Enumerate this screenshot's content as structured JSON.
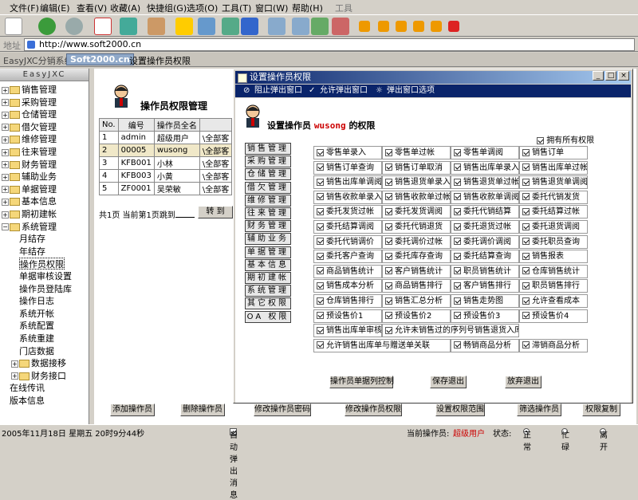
{
  "menu": [
    "文件(F)",
    "编辑(E)",
    "查看(V)",
    "收藏(A)",
    "快捷组(G)",
    "选项(O)",
    "工具(T)",
    "窗口(W)",
    "帮助(H)"
  ],
  "menu_tools": "工具",
  "address": {
    "label": "地址",
    "url": "http://www.soft2000.cn"
  },
  "tabs": {
    "app": "EasyJXC分销系统",
    "logo": "Soft2000.cn",
    "current": "设置操作员权限"
  },
  "sidebar": {
    "header": "EasyJXC",
    "items": [
      "销售管理",
      "采购管理",
      "仓储管理",
      "借欠管理",
      "维修管理",
      "往来管理",
      "财务管理",
      "辅助业务",
      "单据管理",
      "基本信息",
      "期初建帐",
      "系统管理"
    ],
    "sub": [
      "月结存",
      "年结存",
      "操作员权限",
      "单据审核设置",
      "操作员登陆库",
      "操作日志",
      "系统开帐",
      "系统配置",
      "系统重建",
      "门店数据",
      "数据接移",
      "财务接口"
    ],
    "tail": [
      "在线传讯",
      "版本信息"
    ]
  },
  "main": {
    "title": "操作员权限管理",
    "columns": [
      "No.",
      "编号",
      "操作员全名",
      ""
    ],
    "rows": [
      [
        "1",
        "admin",
        "超级用户",
        "\\全部客"
      ],
      [
        "2",
        "00005",
        "wusong",
        "\\全部客"
      ],
      [
        "3",
        "KFB001",
        "小林",
        "\\全部客"
      ],
      [
        "4",
        "KFB003",
        "小黄",
        "\\全部客"
      ],
      [
        "5",
        "ZF0001",
        "吴荣敏",
        "\\全部客"
      ]
    ],
    "pager": {
      "text": "共1页 当前第1页跳到",
      "go": "转 到"
    }
  },
  "bottom_buttons": [
    "添加操作员",
    "删除操作员",
    "修改操作员密码",
    "修改操作员权限",
    "设置权限范围",
    "筛选操作员",
    "权限复制"
  ],
  "status": {
    "datetime": "2005年11月18日 星期五 20时9分44秒",
    "auto_popup": "自动弹出消息",
    "operator_label": "当前操作员:",
    "operator": "超级用户",
    "state_label": "状态:",
    "states": [
      "正常",
      "忙碌",
      "离开"
    ]
  },
  "dialog": {
    "title": "设置操作员权限",
    "bar": [
      "阻止弹出窗口",
      "允许弹出窗口",
      "弹出窗口选项"
    ],
    "heading": "设置操作员",
    "user": "wusong",
    "heading_suffix": "的权限",
    "all_rights": "拥有所有权限",
    "categories": [
      "销售管理",
      "采购管理",
      "仓储管理",
      "借欠管理",
      "维修管理",
      "往来管理",
      "财务管理",
      "辅助业务",
      "单据管理",
      "基本信息",
      "期初建帐",
      "系统管理",
      "其它权限",
      "OA 权限"
    ],
    "permissions": [
      [
        "零售单录入",
        "零售单过帐",
        "零售单调阅",
        "销售订单"
      ],
      [
        "销售订单查询",
        "销售订单取消",
        "销售出库单录入",
        "销售出库单过帐"
      ],
      [
        "销售出库单调阅",
        "销售退货单录入",
        "销售退货单过帐",
        "销售退货单调阅"
      ],
      [
        "销售收款单录入",
        "销售收款单过帐",
        "销售收款单调阅",
        "委托代销发货"
      ],
      [
        "委托发货过帐",
        "委托发货调阅",
        "委托代销结算",
        "委托结算过帐"
      ],
      [
        "委托结算调阅",
        "委托代销退货",
        "委托退货过帐",
        "委托退货调阅"
      ],
      [
        "委托代销调价",
        "委托调价过帐",
        "委托调价调阅",
        "委托职员查询"
      ],
      [
        "委托客户查询",
        "委托库存查询",
        "委托结算查询",
        "销售报表"
      ],
      [
        "商品销售统计",
        "客户销售统计",
        "职员销售统计",
        "仓库销售统计"
      ],
      [
        "销售成本分析",
        "商品销售排行",
        "客户销售排行",
        "职员销售排行"
      ],
      [
        "仓库销售排行",
        "销售汇总分析",
        "销售走势图",
        "允许查看成本"
      ],
      [
        "预设售价1",
        "预设售价2",
        "预设售价3",
        "预设售价4"
      ]
    ],
    "wide_rows": [
      [
        "销售出库单审核",
        "允许未销售过的序列号销售退货入库"
      ],
      [
        "允许销售出库单与赠送单关联",
        "畅销商品分析",
        "滞销商品分析"
      ]
    ],
    "buttons": [
      "操作员单据列控制",
      "保存退出",
      "放弃退出"
    ]
  }
}
